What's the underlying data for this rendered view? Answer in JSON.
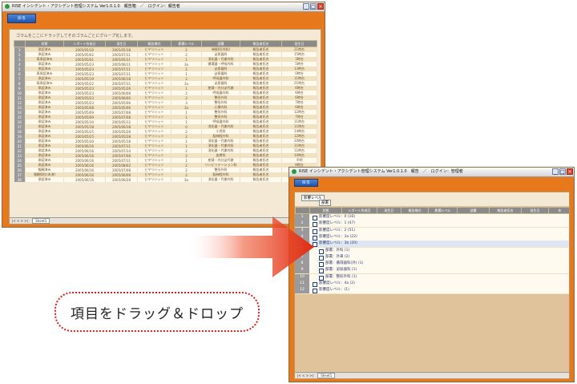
{
  "left_window": {
    "title": "RISE インシデント・アクシデント管理システム Ver1.0.1.0　報告箱　／　ログイン：報告者",
    "back_button": "戻る",
    "hint": "ゴラムをここにドラッグしてそのゴラムごとにグループ化します。",
    "columns": [
      "状態",
      "レポート作成日",
      "発生日",
      "報告様式",
      "影響レベル",
      "部署",
      "報告者氏名",
      "発生日",
      "年"
    ],
    "rows": [
      [
        "承認済み",
        "2005/05/30",
        "2005/05/18",
        "ヒヤリハット",
        "2",
        "神経科(内科)",
        "報告者氏名",
        "21時台",
        "2005"
      ],
      [
        "承認済み",
        "2005/05/02",
        "2005/07/11",
        "ヒヤリハット",
        "2",
        "泌尿器科",
        "報告者氏名",
        "15時台",
        "2005"
      ],
      [
        "再承認済み",
        "2005/05/01",
        "2005/05/11",
        "ヒヤリハット",
        "1",
        "消化器・代謝内科",
        "報告者氏名",
        "3時台",
        "2005"
      ],
      [
        "承認済み",
        "2005/05/23",
        "2005/06/11",
        "ヒヤリハット",
        "3a",
        "循環器・呼吸内科",
        "報告者氏名",
        "5時台",
        "2005"
      ],
      [
        "承認済み",
        "2005/05/23",
        "2005/07/11",
        "ヒヤリハット",
        "2",
        "泌尿器科",
        "報告者氏名",
        "13時台",
        "2005"
      ],
      [
        "再承認済み",
        "2005/05/23",
        "2005/07/11",
        "ヒヤリハット",
        "1",
        "泌尿器科",
        "報告者氏名",
        "0時台",
        "2005"
      ],
      [
        "承認済み",
        "2005/05/19",
        "2005/06/18",
        "ヒヤリハット",
        "2",
        "呼吸器内科",
        "報告者氏名",
        "11時台",
        "2005"
      ],
      [
        "再承認済み",
        "2005/05/22",
        "2005/07/11",
        "ヒヤリハット",
        "3a",
        "泌尿器科",
        "報告者氏名",
        "21時台",
        "2005"
      ],
      [
        "承認済み",
        "2005/05/23",
        "2005/05/26",
        "ヒヤリハット",
        "1",
        "産婦・内分泌代謝",
        "報告者氏名",
        "6時台",
        "2005"
      ],
      [
        "承認済み",
        "2005/05/23",
        "2005/06/08",
        "ヒヤリハット",
        "2",
        "呼吸器内科",
        "報告者氏名",
        "6時台",
        "2005"
      ],
      [
        "承認済み",
        "2005/05/23",
        "2005/06/06",
        "ヒヤリハット",
        "2",
        "整形外科",
        "報告者氏名",
        "6時台",
        "2005"
      ],
      [
        "承認済み",
        "2005/05/23",
        "2005/05/06",
        "ヒヤリハット",
        "3",
        "整形外科",
        "報告者氏名",
        "7時台",
        "2005"
      ],
      [
        "承認済み",
        "2005/05/08",
        "2005/05/06",
        "ヒヤリハット",
        "3a",
        "心療内科",
        "報告者氏名",
        "6時台",
        "2005"
      ],
      [
        "承認済み",
        "2005/05/09",
        "2005/07/08",
        "ヒヤリハット",
        "1",
        "整形外科",
        "報告者氏名",
        "12時台",
        "2005"
      ],
      [
        "承認済み",
        "2005/05/09",
        "2005/07/08",
        "ヒヤリハット",
        "1",
        "整形外科",
        "報告者氏名",
        "7時台",
        "2005"
      ],
      [
        "承認済み",
        "2005/05/10",
        "2005/05/12",
        "ヒヤリハット",
        "1",
        "呼吸器内科",
        "報告者氏名",
        "11時台",
        "2005"
      ],
      [
        "承認済み",
        "2005/05/18",
        "2005/06/18",
        "ヒヤリハット",
        "0",
        "消化器・代謝内科",
        "報告者氏名",
        "11時台",
        "2005"
      ],
      [
        "承認済み",
        "2005/05/25",
        "2005/05/28",
        "ヒヤリハット",
        "2",
        "小児科",
        "報告者氏名",
        "14時台",
        "2005"
      ],
      [
        "承認済み",
        "2005/05/25",
        "2005/05/28",
        "ヒヤリハット",
        "2",
        "脳神経外科",
        "報告者氏名",
        "12時台",
        "2005"
      ],
      [
        "承認済み",
        "2005/05/30",
        "2005/05/18",
        "ヒヤリハット",
        "1",
        "消化器・代謝内科",
        "報告者氏名",
        "20時台",
        "2005"
      ],
      [
        "承認済み",
        "2005/06/16",
        "2005/07/11",
        "ヒヤリハット",
        "1",
        "消化器・代謝内科",
        "報告者氏名",
        "11時台",
        "2005"
      ],
      [
        "承認済み",
        "2005/06/16",
        "2005/07/14",
        "ヒヤリハット",
        "2",
        "消化器・代謝内科",
        "報告者氏名",
        "11時台",
        "2005"
      ],
      [
        "承認済み",
        "2005/06/16",
        "2005/07/08",
        "ヒヤリハット",
        "2",
        "皮膚科",
        "報告者氏名",
        "10時台",
        "2005"
      ],
      [
        "承認済み",
        "2005/06/16",
        "2005/07/11",
        "ヒヤリハット",
        "1",
        "産婦・内分泌代謝",
        "報告者氏名",
        "不明",
        "2005"
      ],
      [
        "承認済み",
        "2005/06/16",
        "2005/08/02",
        "ヒヤリハット",
        "2",
        "リハビリテーション科",
        "報告者氏名",
        "8時台",
        "2005"
      ],
      [
        "報酬済み",
        "2005/06/16",
        "2005/07/08",
        "ヒヤリハット",
        "2",
        "整形外科",
        "報告者氏名",
        "2時台",
        "2005"
      ],
      [
        "報酬保存(未済)",
        "2005/06/16",
        "2005/06/08",
        "ヒヤリハット",
        "2",
        "脳神経外科",
        "報告者氏名",
        "8時台",
        "2005"
      ],
      [
        "承認済み",
        "2005/06/16",
        "2005/06/28",
        "ヒヤリハット",
        "3a",
        "消化器・代謝内科",
        "報告者氏名",
        "6時台",
        "2005"
      ]
    ],
    "sheet_tab": "Sheet1"
  },
  "right_window": {
    "title": "RISE インシデント・アクシデント管理システム Ver1.0.1.0　報告　／　ログイン：管理者",
    "back_button": "戻る",
    "group_chip_1": "影響レベル",
    "group_chip_2": "部署",
    "columns": [
      "状態",
      "レポート作成日",
      "発生日",
      "報告様式",
      "影響レベル",
      "部署",
      "報告者氏名",
      "発生日",
      "年"
    ],
    "groups": [
      {
        "rn": "1",
        "text": "影響度レベル：0 (16)",
        "indent": 1
      },
      {
        "rn": "2",
        "text": "影響度レベル：1 (47)",
        "indent": 1
      },
      {
        "rn": "3",
        "text": "影響度レベル：2 (51)",
        "indent": 1
      },
      {
        "rn": "4",
        "text": "影響度レベル：3a (22)",
        "indent": 1
      },
      {
        "rn": "5",
        "text": "影響度レベル：3b (20)",
        "indent": 1
      },
      {
        "rn": "6",
        "text": "部署：外科 (1)",
        "indent": 2
      },
      {
        "rn": "7",
        "text": "部署：外来 (2)",
        "indent": 2
      },
      {
        "rn": "8",
        "text": "部署：循環器科(外) (1)",
        "indent": 2
      },
      {
        "rn": "9",
        "text": "部署：泌尿器科 (1)",
        "indent": 2
      },
      {
        "rn": "10",
        "text": "部署：整形外科 (1)",
        "indent": 2
      },
      {
        "rn": "11",
        "text": "影響度レベル：4a (2)",
        "indent": 1
      },
      {
        "rn": "12",
        "text": "影響度レベル：(1)",
        "indent": 1
      }
    ],
    "sheet_tab": "Sheet1"
  },
  "callout": {
    "text": "項目をドラッグ＆ドロップ"
  },
  "colors": {
    "window": "#e8781c",
    "panel": "#f3e9d5",
    "arrow": "#e83a1a"
  }
}
